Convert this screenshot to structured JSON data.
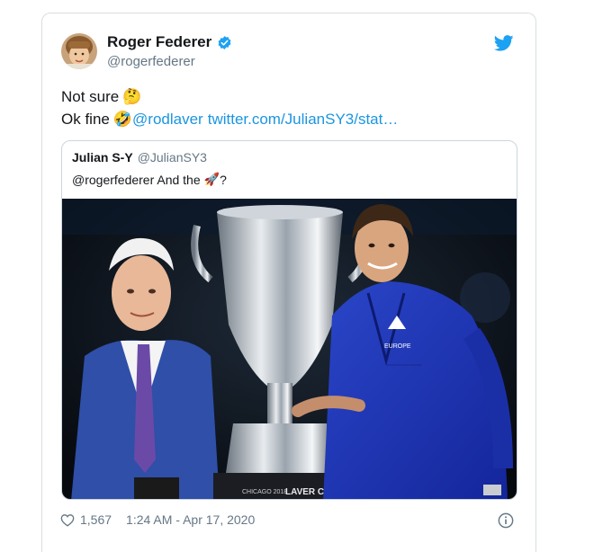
{
  "author": {
    "name": "Roger Federer",
    "handle": "@rogerfederer",
    "verified": true
  },
  "tweet": {
    "line1_text": "Not sure",
    "line1_emoji": "🤔",
    "line2_text": "Ok fine",
    "line2_emoji": "🤣",
    "mention": "@rodlaver",
    "url": "twitter.com/JulianSY3/stat…"
  },
  "quoted": {
    "name": "Julian S-Y",
    "handle": "@JulianSY3",
    "text": "@rogerfederer And the",
    "emoji": "🚀",
    "suffix": "?",
    "photo": {
      "trophy_text": "LAVER CUP",
      "trophy_small_text": "CHICAGO 2018",
      "jacket_text": "EUROPE"
    }
  },
  "footer": {
    "likes": "1,567",
    "timestamp": "1:24 AM - Apr 17, 2020"
  },
  "icons": {
    "verified": "verified-badge-icon",
    "twitter": "twitter-bird-icon",
    "heart": "heart-icon",
    "info": "info-icon"
  },
  "colors": {
    "link": "#1b95e0",
    "verified": "#1da1f2",
    "muted": "#657786"
  }
}
